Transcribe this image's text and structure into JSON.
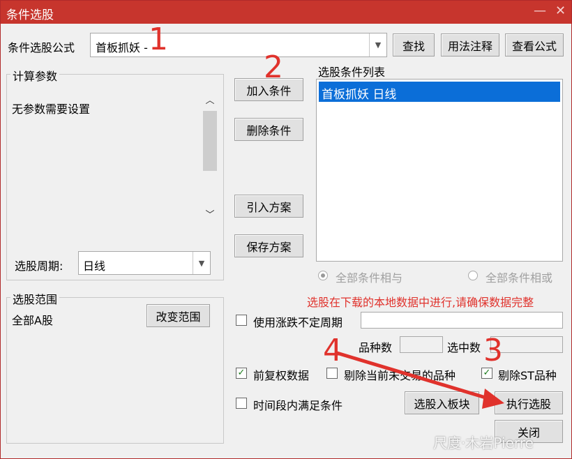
{
  "window": {
    "title": "条件选股",
    "minimize": "—",
    "close": "✕"
  },
  "formula": {
    "label": "条件选股公式",
    "value": "首板抓妖 -",
    "find": "查找",
    "usage": "用法注释",
    "view": "查看公式"
  },
  "params": {
    "group": "计算参数",
    "text": "无参数需要设置",
    "period_label": "选股周期:",
    "period_value": "日线"
  },
  "actions": {
    "add": "加入条件",
    "delete": "删除条件",
    "import": "引入方案",
    "save": "保存方案"
  },
  "condlist": {
    "label": "选股条件列表",
    "items": [
      "首板抓妖  日线"
    ]
  },
  "logic": {
    "and": "全部条件相与",
    "or": "全部条件相或"
  },
  "notice": "选股在下载的本地数据中进行,请确保数据完整",
  "range": {
    "group": "选股范围",
    "value": "全部A股",
    "change": "改变范围"
  },
  "options": {
    "variable_period": "使用涨跌不定周期",
    "count_label": "品种数",
    "selected_label": "选中数",
    "forward_adjust": "前复权数据",
    "exclude_untraded": "剔除当前未交易的品种",
    "exclude_st": "剔除ST品种",
    "time_condition": "时间段内满足条件"
  },
  "bottom": {
    "to_block": "选股入板块",
    "execute": "执行选股",
    "close": "关闭"
  },
  "annotations": [
    "1",
    "2",
    "3",
    "4"
  ],
  "watermark": "尺度·木岩Pierre",
  "colors": {
    "title_bar": "#c7352d",
    "selection": "#0b6ed8",
    "notice": "#e0322c",
    "annotation": "#e0322c"
  }
}
